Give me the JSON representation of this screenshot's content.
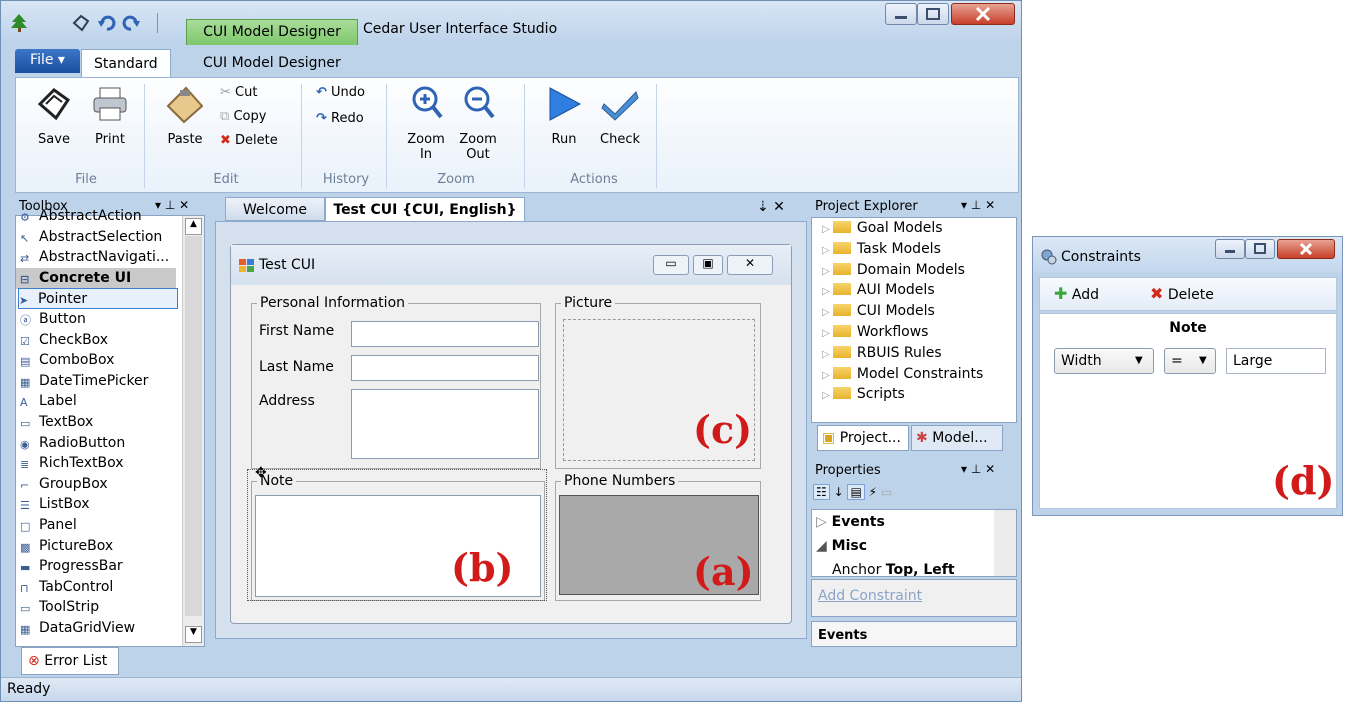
{
  "window": {
    "title": "Cedar User Interface Studio",
    "contextual_tab": "CUI Model Designer"
  },
  "ribbon": {
    "file_tab": "File ▾",
    "tabs": [
      "Standard",
      "CUI Model Designer"
    ],
    "groups": {
      "file": {
        "label": "File",
        "save": "Save",
        "print": "Print"
      },
      "edit": {
        "label": "Edit",
        "paste": "Paste",
        "cut": "Cut",
        "copy": "Copy",
        "delete": "Delete"
      },
      "history": {
        "label": "History",
        "undo": "Undo",
        "redo": "Redo"
      },
      "zoom": {
        "label": "Zoom",
        "zoom_in_1": "Zoom",
        "zoom_in_2": "In",
        "zoom_out_1": "Zoom",
        "zoom_out_2": "Out"
      },
      "actions": {
        "label": "Actions",
        "run": "Run",
        "check": "Check"
      }
    }
  },
  "toolbox": {
    "title": "Toolbox",
    "items": [
      {
        "label": "AbstractAction",
        "icon": "abstract-action-icon"
      },
      {
        "label": "AbstractSelection",
        "icon": "cursor-icon"
      },
      {
        "label": "AbstractNavigati...",
        "icon": "navigation-icon"
      },
      {
        "label": "Concrete UI",
        "icon": "collapse-icon",
        "header": true
      },
      {
        "label": "Pointer",
        "icon": "pointer-icon",
        "selected": true
      },
      {
        "label": "Button",
        "icon": "button-icon"
      },
      {
        "label": "CheckBox",
        "icon": "checkbox-icon"
      },
      {
        "label": "ComboBox",
        "icon": "combobox-icon"
      },
      {
        "label": "DateTimePicker",
        "icon": "datetime-icon"
      },
      {
        "label": "Label",
        "icon": "label-icon"
      },
      {
        "label": "TextBox",
        "icon": "textbox-icon"
      },
      {
        "label": "RadioButton",
        "icon": "radio-icon"
      },
      {
        "label": "RichTextBox",
        "icon": "richtext-icon"
      },
      {
        "label": "GroupBox",
        "icon": "groupbox-icon"
      },
      {
        "label": "ListBox",
        "icon": "listbox-icon"
      },
      {
        "label": "Panel",
        "icon": "panel-icon"
      },
      {
        "label": "PictureBox",
        "icon": "picture-icon"
      },
      {
        "label": "ProgressBar",
        "icon": "progress-icon"
      },
      {
        "label": "TabControl",
        "icon": "tabcontrol-icon"
      },
      {
        "label": "ToolStrip",
        "icon": "toolstrip-icon"
      },
      {
        "label": "DataGridView",
        "icon": "datagrid-icon"
      }
    ]
  },
  "documents": {
    "tabs": [
      "Welcome",
      "Test CUI {CUI, English}"
    ],
    "active": 1
  },
  "form": {
    "title": "Test CUI",
    "personal_info": "Personal Information",
    "first_name": "First Name",
    "last_name": "Last Name",
    "address": "Address",
    "picture": "Picture",
    "note": "Note",
    "phone_numbers": "Phone Numbers"
  },
  "callouts": {
    "a": "(a)",
    "b": "(b)",
    "c": "(c)",
    "d": "(d)"
  },
  "project_explorer": {
    "title": "Project Explorer",
    "items": [
      "Goal Models",
      "Task Models",
      "Domain Models",
      "AUI Models",
      "CUI Models",
      "Workflows",
      "RBUIS Rules",
      "Model Constraints",
      "Scripts"
    ],
    "tabs": [
      "Project...",
      "Model..."
    ]
  },
  "properties": {
    "title": "Properties",
    "rows": [
      "Events",
      "Misc",
      "Anchor"
    ],
    "anchor_value": "Top, Left",
    "add_constraint": "Add Constraint",
    "bottom_label": "Events"
  },
  "bottom": {
    "error_list": "Error List",
    "status": "Ready"
  },
  "constraints": {
    "title": "Constraints",
    "add": "Add",
    "delete": "Delete",
    "heading": "Note",
    "property": "Width",
    "operator": "=",
    "value": "Large"
  }
}
